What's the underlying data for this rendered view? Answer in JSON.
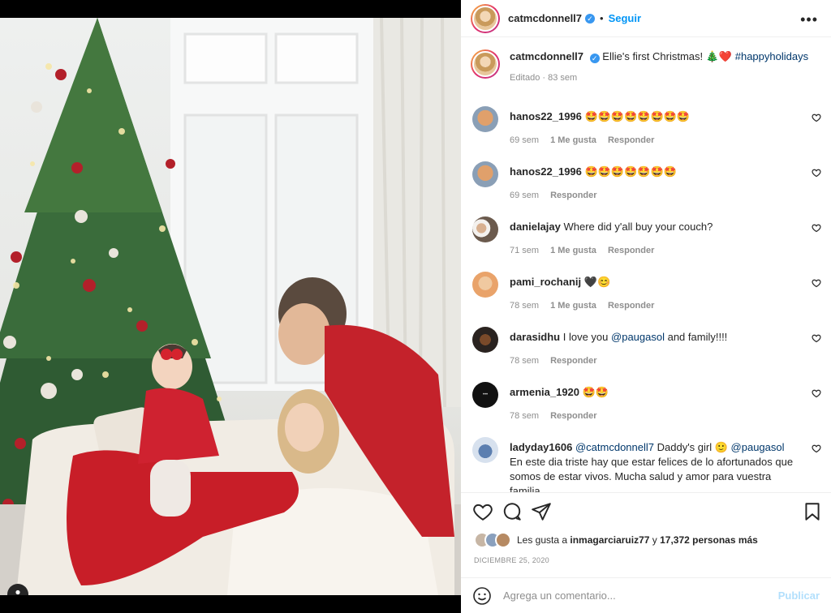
{
  "post": {
    "author": "catmcdonnell7",
    "follow_label": "Seguir",
    "more_label": "•••",
    "caption_text": "Ellie's first Christmas! 🎄❤️",
    "caption_hashtag": "#happyholidays",
    "caption_meta": "Editado · 83 sem"
  },
  "comments": [
    {
      "user": "hanos22_1996",
      "text": "🤩🤩🤩🤩🤩🤩🤩🤩",
      "time": "69 sem",
      "likes": "1 Me gusta",
      "reply": "Responder"
    },
    {
      "user": "hanos22_1996",
      "text": "🤩🤩🤩🤩🤩🤩🤩",
      "time": "69 sem",
      "likes": "",
      "reply": "Responder"
    },
    {
      "user": "danielajay",
      "text": "Where did y'all buy your couch?",
      "time": "71 sem",
      "likes": "1 Me gusta",
      "reply": "Responder"
    },
    {
      "user": "pami_rochanij",
      "text": "🖤😊",
      "time": "78 sem",
      "likes": "1 Me gusta",
      "reply": "Responder"
    },
    {
      "user": "darasidhu",
      "text_pre": "I love you ",
      "mention": "@paugasol",
      "text_post": " and family!!!!",
      "time": "78 sem",
      "likes": "",
      "reply": "Responder"
    },
    {
      "user": "armenia_1920",
      "text": "🤩🤩",
      "time": "78 sem",
      "likes": "",
      "reply": "Responder"
    },
    {
      "user": "ladyday1606",
      "mention1": "@catmcdonnell7",
      "text_mid": " Daddy's girl 🙂 ",
      "mention2": "@paugasol",
      "text_post": " En este dia triste hay que estar felices de lo afortunados que somos de estar vivos. Mucha salud y amor para vuestra familia.",
      "time": "",
      "likes": "",
      "reply": ""
    }
  ],
  "likes": {
    "prefix": "Les gusta a ",
    "user": "inmagarciaruiz77",
    "middle": " y ",
    "count": "17,372 personas más"
  },
  "date": "DICIEMBRE 25, 2020",
  "add_comment": {
    "placeholder": "Agrega un comentario...",
    "publish": "Publicar"
  },
  "icons": {
    "like": "heart-icon",
    "comment": "comment-icon",
    "share": "paper-plane-icon",
    "save": "bookmark-icon",
    "emoji": "smiley-icon",
    "tags": "user-tag-icon"
  }
}
